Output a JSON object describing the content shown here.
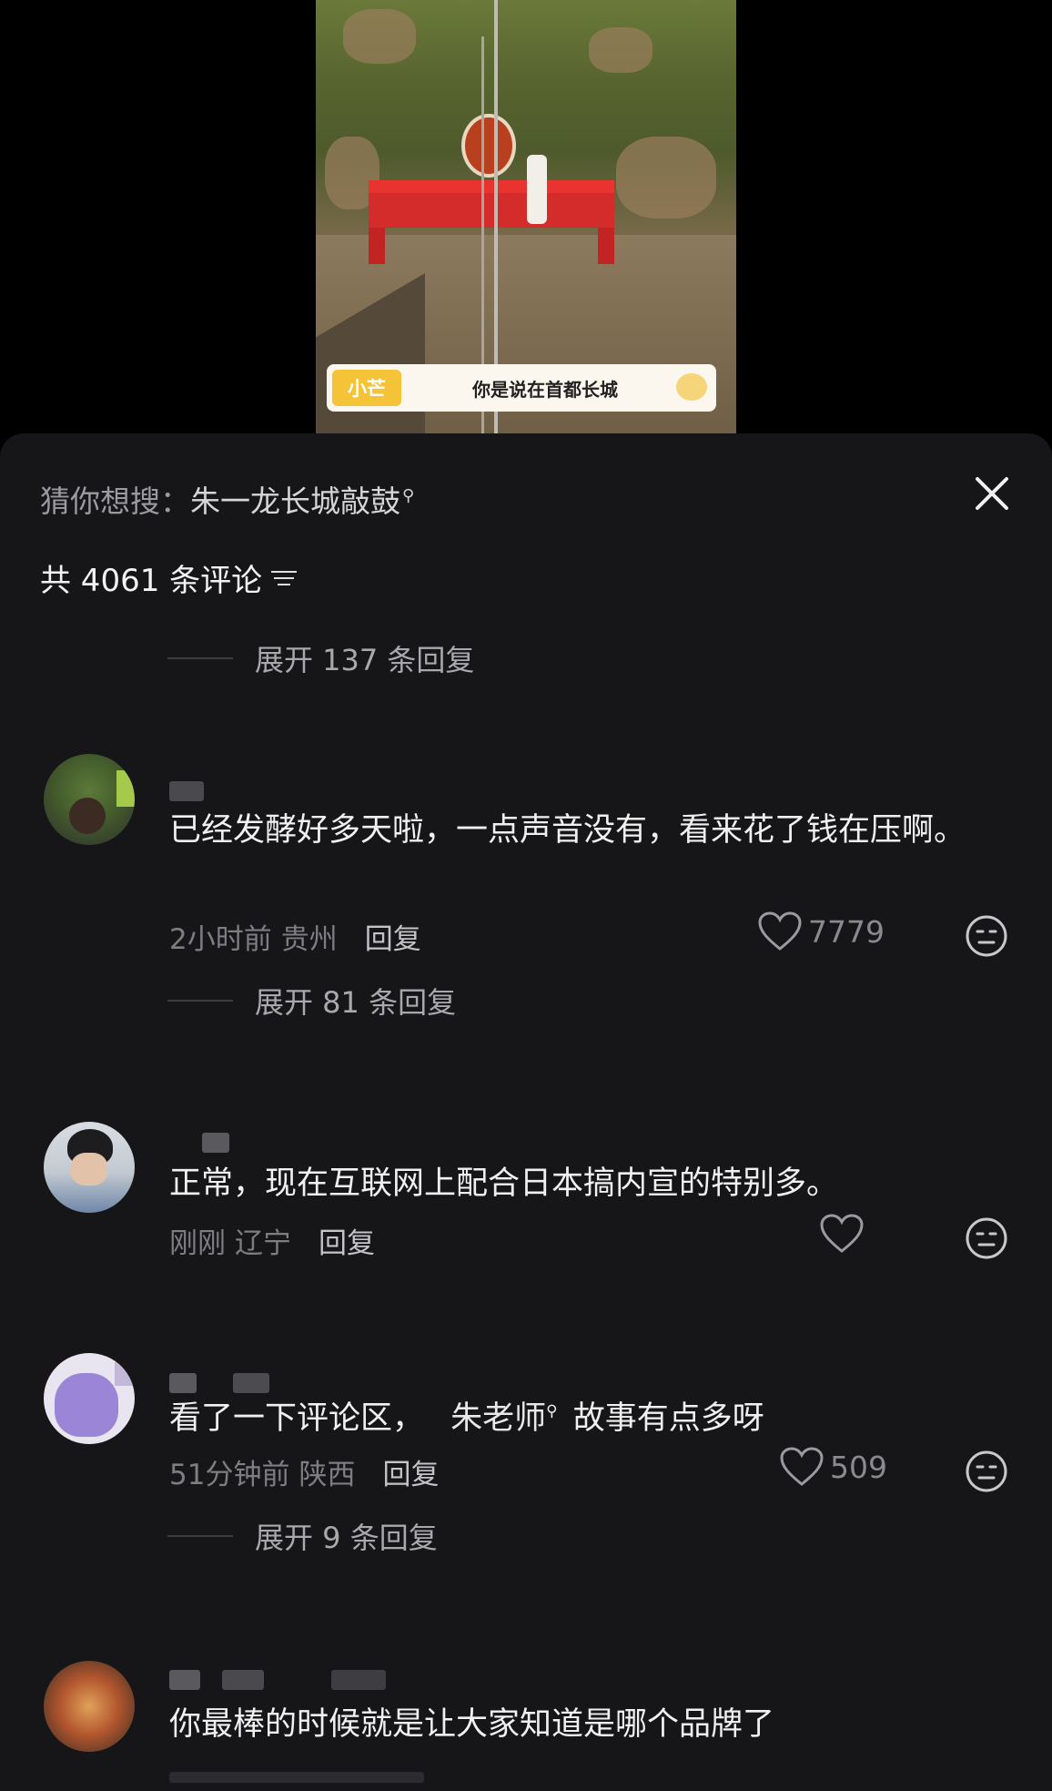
{
  "video": {
    "caption_tag": "小芒",
    "caption_text": "你是说在首都长城"
  },
  "sheet": {
    "suggest_prefix": "猜你想搜：",
    "suggest_query": "朱一龙长城敲鼓",
    "comment_count": "共 4061 条评论",
    "expand_top": "展开 137 条回复",
    "comments": [
      {
        "text": "已经发酵好多天啦，一点声音没有，看来花了钱在压啊。",
        "time": "2小时前",
        "location": "贵州",
        "reply": "回复",
        "likes": "7779",
        "expand": "展开 81 条回复"
      },
      {
        "text": "正常，现在互联网上配合日本搞内宣的特别多。",
        "time": "刚刚",
        "location": "辽宁",
        "reply": "回复",
        "likes": ""
      },
      {
        "text_before": "看了一下评论区，",
        "mention": "朱老师",
        "text_after": "故事有点多呀",
        "time": "51分钟前",
        "location": "陕西",
        "reply": "回复",
        "likes": "509",
        "expand": "展开 9 条回复"
      },
      {
        "text": "你最棒的时候就是让大家知道是哪个品牌了"
      }
    ]
  },
  "colors": {
    "sheet_bg": "#161619",
    "caption_tag_bg": "#f5c338",
    "stage_red": "#d42b2b"
  },
  "icons": {
    "close": "close-icon",
    "filter": "filter-icon",
    "like": "heart-icon",
    "reaction": "neutral-face-icon",
    "search_hint": "magnifier-icon"
  }
}
